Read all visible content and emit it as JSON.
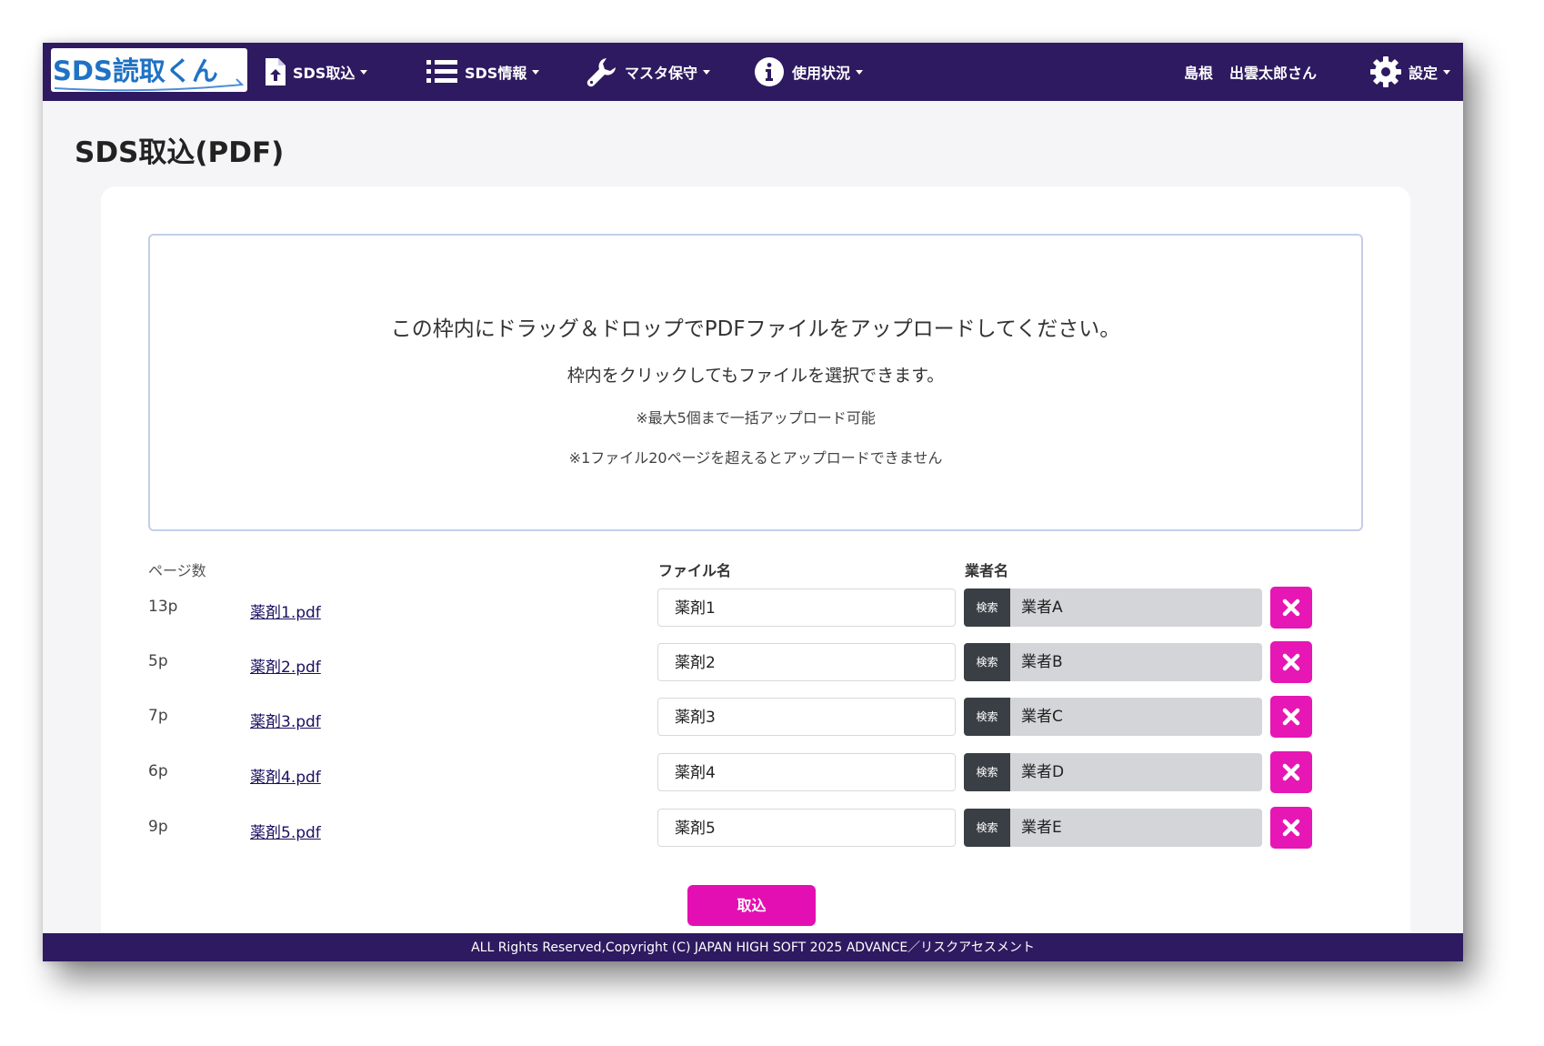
{
  "app": {
    "logo_text": "SDS読取くん"
  },
  "nav": {
    "items": [
      {
        "label": "SDS取込",
        "icon": "file-upload-icon"
      },
      {
        "label": "SDS情報",
        "icon": "list-icon"
      },
      {
        "label": "マスタ保守",
        "icon": "wrench-icon"
      },
      {
        "label": "使用状況",
        "icon": "info-circle-icon"
      }
    ],
    "user": {
      "prefecture": "島根",
      "name": "出雲太郎さん"
    },
    "settings": {
      "label": "設定",
      "icon": "gear-icon"
    }
  },
  "page": {
    "title": "SDS取込(PDF)"
  },
  "dropzone": {
    "main": "この枠内にドラッグ＆ドロップでPDFファイルをアップロードしてください。",
    "sub": "枠内をクリックしてもファイルを選択できます。",
    "note1": "※最大5個まで一括アップロード可能",
    "note2": "※1ファイル20ページを超えるとアップロードできません"
  },
  "table": {
    "headers": {
      "pages": "ページ数",
      "file_name": "ファイル名",
      "vendor": "業者名"
    },
    "search_label": "検索",
    "rows": [
      {
        "pages": "13p",
        "file": "薬剤1.pdf",
        "file_name": "薬剤1",
        "vendor": "業者A"
      },
      {
        "pages": "5p",
        "file": "薬剤2.pdf",
        "file_name": "薬剤2",
        "vendor": "業者B"
      },
      {
        "pages": "7p",
        "file": "薬剤3.pdf",
        "file_name": "薬剤3",
        "vendor": "業者C"
      },
      {
        "pages": "6p",
        "file": "薬剤4.pdf",
        "file_name": "薬剤4",
        "vendor": "業者D"
      },
      {
        "pages": "9p",
        "file": "薬剤5.pdf",
        "file_name": "薬剤5",
        "vendor": "業者E"
      }
    ]
  },
  "submit_label": "取込",
  "footer": {
    "copyright": "ALL Rights Reserved,Copyright (C) JAPAN HIGH SOFT 2025 ADVANCE／リスクアセスメント"
  },
  "colors": {
    "navbar": "#2e1a60",
    "accent_pink": "#e617b4",
    "logo_blue": "#1f72c4",
    "search_button": "#3a3f45",
    "vendor_field": "#d3d5d8"
  }
}
